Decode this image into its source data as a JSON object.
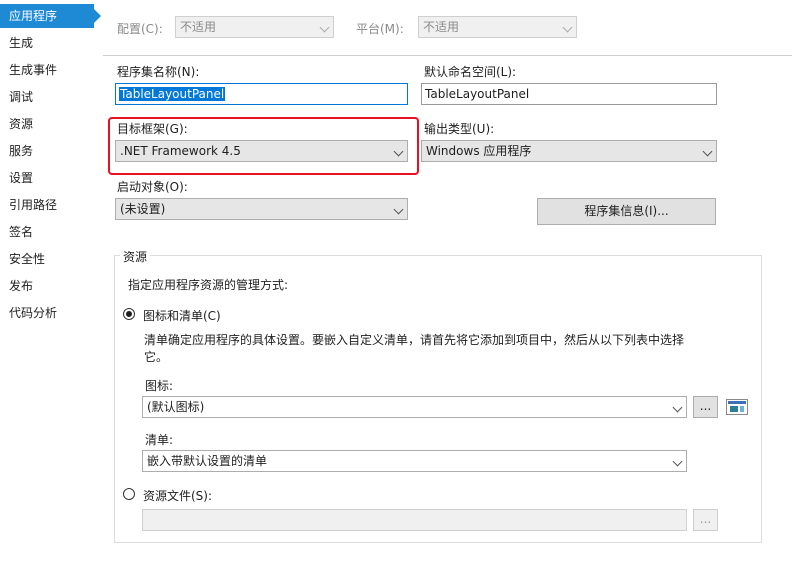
{
  "sidebar": {
    "items": [
      {
        "label": "应用程序",
        "active": true
      },
      {
        "label": "生成"
      },
      {
        "label": "生成事件"
      },
      {
        "label": "调试"
      },
      {
        "label": "资源"
      },
      {
        "label": "服务"
      },
      {
        "label": "设置"
      },
      {
        "label": "引用路径"
      },
      {
        "label": "签名"
      },
      {
        "label": "安全性"
      },
      {
        "label": "发布"
      },
      {
        "label": "代码分析"
      }
    ]
  },
  "toolbar": {
    "config_label": "配置(C):",
    "config_value": "不适用",
    "platform_label": "平台(M):",
    "platform_value": "不适用"
  },
  "app": {
    "assembly_name_label": "程序集名称(N):",
    "assembly_name_value": "TableLayoutPanel",
    "namespace_label": "默认命名空间(L):",
    "namespace_value": "TableLayoutPanel",
    "target_framework_label": "目标框架(G):",
    "target_framework_value": ".NET Framework 4.5",
    "output_type_label": "输出类型(U):",
    "output_type_value": "Windows 应用程序",
    "startup_label": "启动对象(O):",
    "startup_value": "(未设置)",
    "assembly_info_button": "程序集信息(I)..."
  },
  "resources": {
    "group_title": "资源",
    "description": "指定应用程序资源的管理方式:",
    "icon_manifest_label": "图标和清单(C)",
    "icon_manifest_desc_line1": "清单确定应用程序的具体设置。要嵌入自定义清单，请首先将它添加到项目中，然后从以下列表中选择",
    "icon_manifest_desc_line2": "它。",
    "icon_label": "图标:",
    "icon_value": "(默认图标)",
    "browse_label": "...",
    "manifest_label": "清单:",
    "manifest_value": "嵌入带默认设置的清单",
    "resource_file_label": "资源文件(S):",
    "resource_file_value": "",
    "resource_browse_label": "..."
  },
  "colors": {
    "accent": "#1e8ad6",
    "highlight": "#e81123"
  }
}
